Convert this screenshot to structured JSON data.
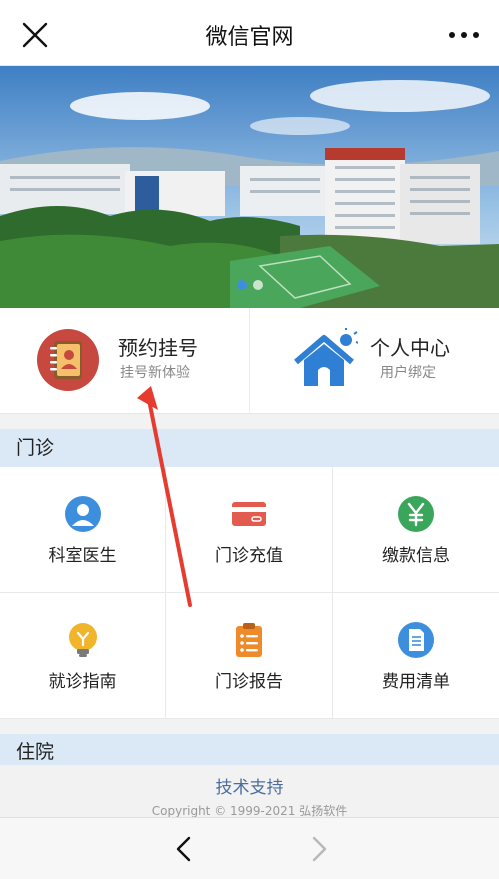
{
  "header": {
    "title": "微信官网"
  },
  "banner": {
    "pages": 2,
    "active_page": 1
  },
  "quick_actions": [
    {
      "title": "预约挂号",
      "subtitle": "挂号新体验"
    },
    {
      "title": "个人中心",
      "subtitle": "用户绑定"
    }
  ],
  "outpatient": {
    "heading": "门诊",
    "items": [
      {
        "label": "科室医生",
        "icon": "doctor-icon",
        "color": "#3d8fdd"
      },
      {
        "label": "门诊充值",
        "icon": "card-icon",
        "color": "#e35a4f"
      },
      {
        "label": "缴款信息",
        "icon": "yuan-icon",
        "color": "#3aa65b"
      },
      {
        "label": "就诊指南",
        "icon": "bulb-icon",
        "color": "#f0b52a"
      },
      {
        "label": "门诊报告",
        "icon": "clipboard-icon",
        "color": "#ef8a2a"
      },
      {
        "label": "费用清单",
        "icon": "document-icon",
        "color": "#3d8fdd"
      }
    ]
  },
  "inpatient": {
    "heading": "住院"
  },
  "footer": {
    "support": "技术支持",
    "copyright": "Copyright © 1999-2021 弘扬软件"
  },
  "colors": {
    "section_bg": "#dbe9f6",
    "accent_red": "#e63b2e",
    "accent_blue": "#3d8fdd"
  }
}
